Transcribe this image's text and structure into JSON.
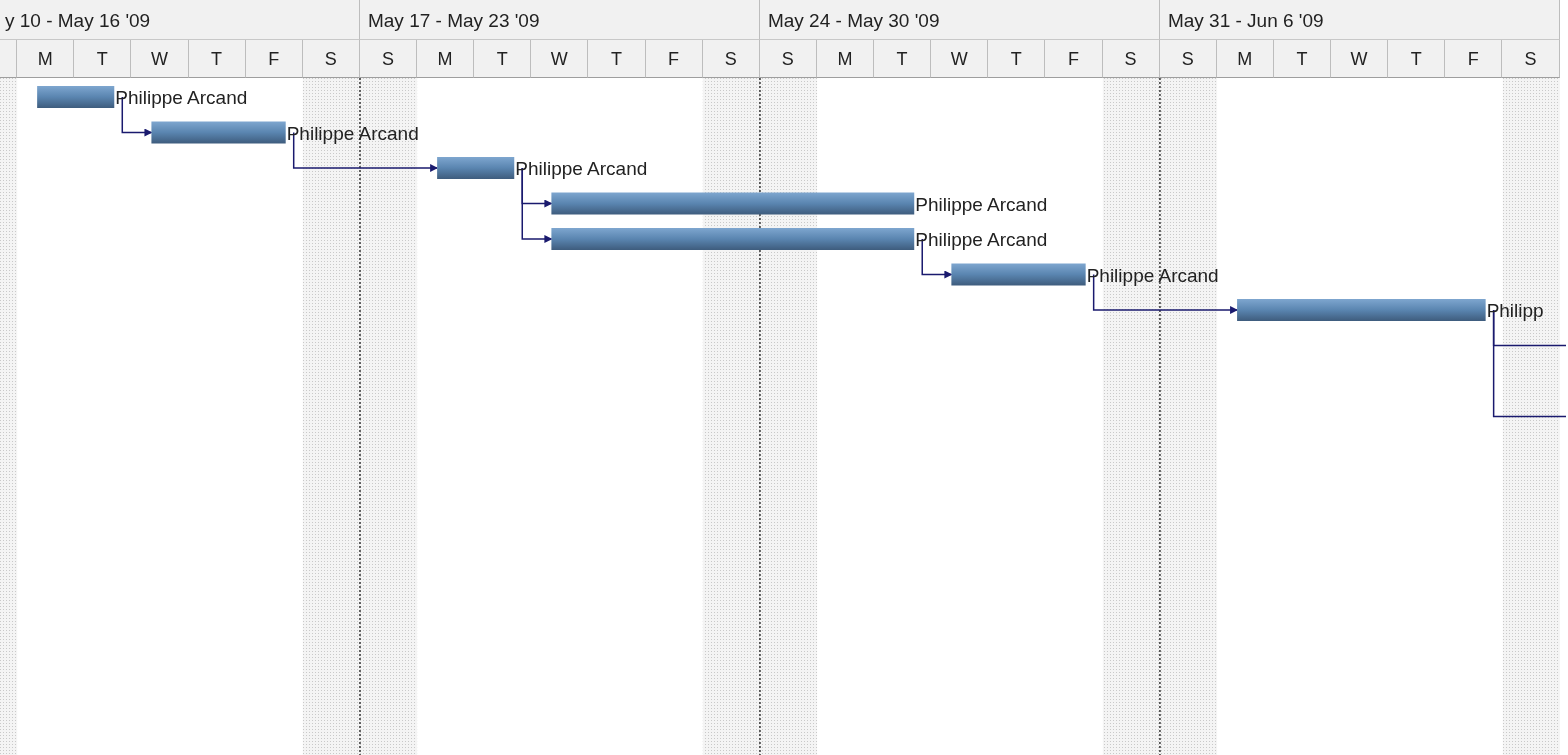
{
  "timeline": {
    "weeks": [
      {
        "label": "y 10 - May 16 '09",
        "days": [
          {
            "weekend": true
          },
          {
            "letter": "M",
            "weekend": false
          },
          {
            "letter": "T",
            "weekend": false
          },
          {
            "letter": "W",
            "weekend": false
          },
          {
            "letter": "T",
            "weekend": false
          },
          {
            "letter": "F",
            "weekend": false
          },
          {
            "letter": "S",
            "weekend": true
          }
        ]
      },
      {
        "label": "May 17 - May 23 '09",
        "days": [
          {
            "letter": "S",
            "weekend": true
          },
          {
            "letter": "M",
            "weekend": false
          },
          {
            "letter": "T",
            "weekend": false
          },
          {
            "letter": "W",
            "weekend": false
          },
          {
            "letter": "T",
            "weekend": false
          },
          {
            "letter": "F",
            "weekend": false
          },
          {
            "letter": "S",
            "weekend": true
          }
        ]
      },
      {
        "label": "May 24 - May 30 '09",
        "days": [
          {
            "letter": "S",
            "weekend": true
          },
          {
            "letter": "M",
            "weekend": false
          },
          {
            "letter": "T",
            "weekend": false
          },
          {
            "letter": "W",
            "weekend": false
          },
          {
            "letter": "T",
            "weekend": false
          },
          {
            "letter": "F",
            "weekend": false
          },
          {
            "letter": "S",
            "weekend": true
          }
        ]
      },
      {
        "label": "May 31 - Jun 6 '09",
        "days": [
          {
            "letter": "S",
            "weekend": true
          },
          {
            "letter": "M",
            "weekend": false
          },
          {
            "letter": "T",
            "weekend": false
          },
          {
            "letter": "W",
            "weekend": false
          },
          {
            "letter": "T",
            "weekend": false
          },
          {
            "letter": "F",
            "weekend": false
          },
          {
            "letter": "S",
            "weekend": true
          }
        ]
      }
    ]
  },
  "tasks": [
    {
      "resource": "Philippe Arcand"
    },
    {
      "resource": "Philippe Arcand"
    },
    {
      "resource": "Philippe Arcand"
    },
    {
      "resource": "Philippe Arcand"
    },
    {
      "resource": "Philippe Arcand"
    },
    {
      "resource": "Philippe Arcand"
    },
    {
      "resource": "Philipp"
    }
  ]
}
